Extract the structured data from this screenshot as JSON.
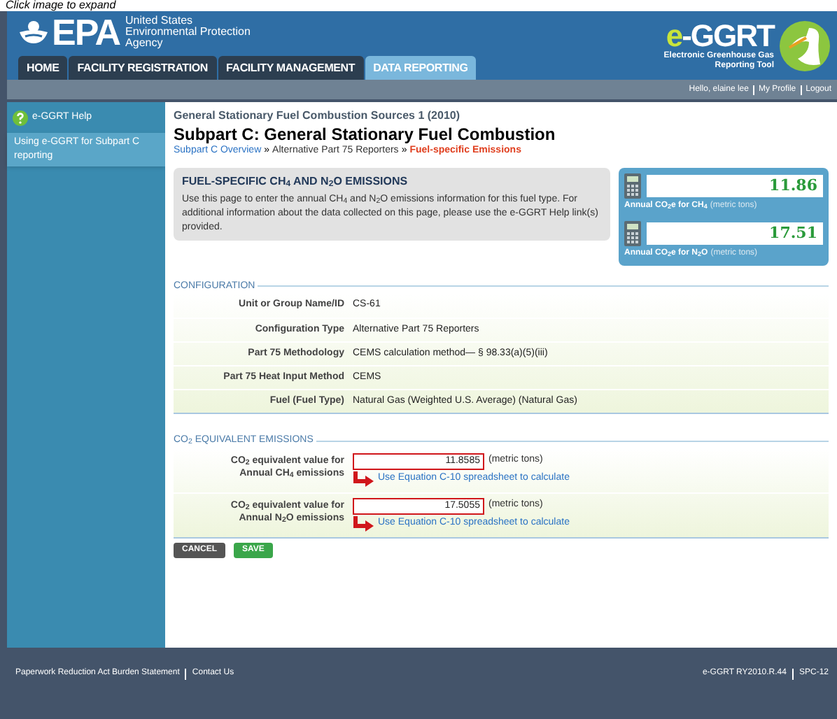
{
  "caption": "Click image to expand",
  "header": {
    "logo": "EPA",
    "agency_lines": [
      "United States",
      "Environmental Protection",
      "Agency"
    ],
    "app_logo": [
      "e",
      "-GGRT"
    ],
    "app_subtitle": [
      "Electronic Greenhouse Gas",
      "Reporting Tool"
    ]
  },
  "tabs": [
    {
      "label": "HOME",
      "selected": false
    },
    {
      "label": "FACILITY REGISTRATION",
      "selected": false
    },
    {
      "label": "FACILITY MANAGEMENT",
      "selected": false
    },
    {
      "label": "DATA REPORTING",
      "selected": true
    }
  ],
  "user_bar": [
    "Hello, elaine lee",
    "My Profile",
    "Logout"
  ],
  "sidebar": {
    "help": "e-GGRT Help",
    "items": [
      {
        "label": "Using e-GGRT for Subpart C reporting",
        "selected": true
      }
    ]
  },
  "page": {
    "supertitle": "General Stationary Fuel Combustion Sources 1 (2010)",
    "title": "Subpart C: General Stationary Fuel Combustion",
    "breadcrumb_separator": "»",
    "breadcrumb": [
      {
        "label": "Subpart C Overview",
        "kind": "link"
      },
      {
        "label": "Alternative Part 75 Reporters",
        "kind": "text"
      },
      {
        "label": "Fuel-specific Emissions",
        "kind": "current"
      }
    ],
    "intro": {
      "heading": "FUEL-SPECIFIC CH$_{4}$ AND N$_{2}$O EMISSIONS",
      "text": "Use this page to enter the annual CH$_{4}$ and N$_{2}$O emissions information for this fuel type. For additional information about the data collected on this page, please use the e-GGRT Help link(s) provided."
    },
    "totals": [
      {
        "value": "11.86",
        "label": "Annual CO$_{2}$e for CH$_{4}$",
        "unit": "(metric tons)"
      },
      {
        "value": "17.51",
        "label": "Annual CO$_{2}$e for N$_{2}$O",
        "unit": "(metric tons)"
      }
    ],
    "configuration": {
      "title": "CONFIGURATION",
      "rows": [
        {
          "label": "Unit or Group Name/ID",
          "value": "CS-61"
        },
        {
          "label": "Configuration Type",
          "value": "Alternative Part 75 Reporters"
        },
        {
          "label": "Part 75 Methodology",
          "value": "CEMS calculation method— § 98.33(a)(5)(iii)"
        },
        {
          "label": "Part 75 Heat Input Method",
          "value": "CEMS"
        },
        {
          "label": "Fuel (Fuel Type)",
          "value": "Natural Gas (Weighted U.S. Average) (Natural Gas)"
        }
      ]
    },
    "co2_equivalent": {
      "title": "CO$_{2}$ EQUIVALENT EMISSIONS",
      "rows": [
        {
          "label": "CO$_{2}$ equivalent value for Annual CH$_{4}$ emissions",
          "value": "11.8585",
          "unit": "(metric tons)",
          "link": "Use Equation C-10 spreadsheet to calculate"
        },
        {
          "label": "CO$_{2}$ equivalent value for Annual N$_{2}$O emissions",
          "value": "17.5055",
          "unit": "(metric tons)",
          "link": "Use Equation C-10 spreadsheet to calculate"
        }
      ]
    },
    "buttons": [
      {
        "label": "CANCEL",
        "kind": "cancel"
      },
      {
        "label": "SAVE",
        "kind": "save"
      }
    ]
  },
  "footer": {
    "left": [
      "Paperwork Reduction Act Burden Statement",
      "Contact Us"
    ],
    "right": [
      "e-GGRT RY2010.R.44",
      "SPC-12"
    ]
  }
}
